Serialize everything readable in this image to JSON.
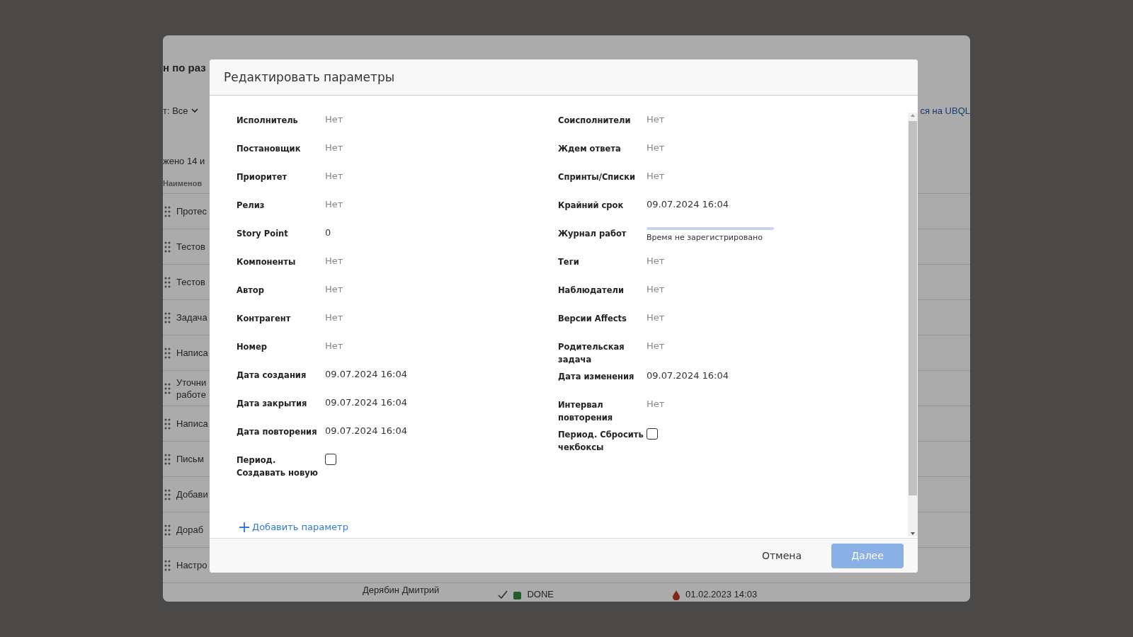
{
  "background": {
    "heading": "н по раз",
    "filter": "т: Все",
    "count": "жено 14 и",
    "link": "ся на UBQL",
    "column_header": "Наименов",
    "rows": [
      "Протес",
      "Тестов",
      "Тестов",
      "Задача",
      "Написа",
      "Уточни работе",
      "Написа",
      "Письм",
      "Добави",
      "Дораб",
      "Настро"
    ],
    "partial_row": {
      "assignee": "Дерябин Дмитрий",
      "status": "DONE",
      "color": "#1f5d2a",
      "date": "01.02.2023 14:03"
    }
  },
  "dialog": {
    "title": "Редактировать параметры",
    "left": [
      {
        "kind": "value",
        "label": "Исполнитель",
        "value": "Нет",
        "empty": true
      },
      {
        "kind": "value",
        "label": "Постановщик",
        "value": "Нет",
        "empty": true
      },
      {
        "kind": "value",
        "label": "Приоритет",
        "value": "Нет",
        "empty": true
      },
      {
        "kind": "value",
        "label": "Релиз",
        "value": "Нет",
        "empty": true
      },
      {
        "kind": "value",
        "label": "Story Point",
        "value": "0",
        "empty": false
      },
      {
        "kind": "value",
        "label": "Компоненты",
        "value": "Нет",
        "empty": true
      },
      {
        "kind": "value",
        "label": "Автор",
        "value": "Нет",
        "empty": true
      },
      {
        "kind": "value",
        "label": "Контрагент",
        "value": "Нет",
        "empty": true
      },
      {
        "kind": "value",
        "label": "Номер",
        "value": "Нет",
        "empty": true
      },
      {
        "kind": "value",
        "label": "Дата создания",
        "value": "09.07.2024 16:04",
        "empty": false
      },
      {
        "kind": "value",
        "label": "Дата закрытия",
        "value": "09.07.2024 16:04",
        "empty": false
      },
      {
        "kind": "value",
        "label": "Дата повторения",
        "value": "09.07.2024 16:04",
        "empty": false
      },
      {
        "kind": "checkbox",
        "label": "Период. Создавать новую",
        "checked": false
      }
    ],
    "right": [
      {
        "kind": "value",
        "label": "Соисполнители",
        "value": "Нет",
        "empty": true
      },
      {
        "kind": "value",
        "label": "Ждем ответа",
        "value": "Нет",
        "empty": true
      },
      {
        "kind": "value",
        "label": "Спринты/Списки",
        "value": "Нет",
        "empty": true
      },
      {
        "kind": "value",
        "label": "Крайний срок",
        "value": "09.07.2024 16:04",
        "empty": false
      },
      {
        "kind": "progress",
        "label": "Журнал работ",
        "level": 0,
        "caption": "Время не зарегистрировано"
      },
      {
        "kind": "value",
        "label": "Теги",
        "value": "Нет",
        "empty": true
      },
      {
        "kind": "value",
        "label": "Наблюдатели",
        "value": "Нет",
        "empty": true
      },
      {
        "kind": "value",
        "label": "Версии Affects",
        "value": "Нет",
        "empty": true
      },
      {
        "kind": "value",
        "label": "Родительская задача",
        "value": "Нет",
        "empty": true
      },
      {
        "kind": "value",
        "label": "Дата изменения",
        "value": "09.07.2024 16:04",
        "empty": false
      },
      {
        "kind": "value",
        "label": "Интервал повторения",
        "value": "Нет",
        "empty": true
      },
      {
        "kind": "checkbox",
        "label": "Период. Сбросить чекбоксы",
        "checked": false
      }
    ],
    "add_link": "Добавить параметр",
    "buttons": [
      {
        "label": "Отмена",
        "kind": "text",
        "disabled": false
      },
      {
        "label": "Далее",
        "kind": "primary",
        "disabled": true
      }
    ]
  }
}
